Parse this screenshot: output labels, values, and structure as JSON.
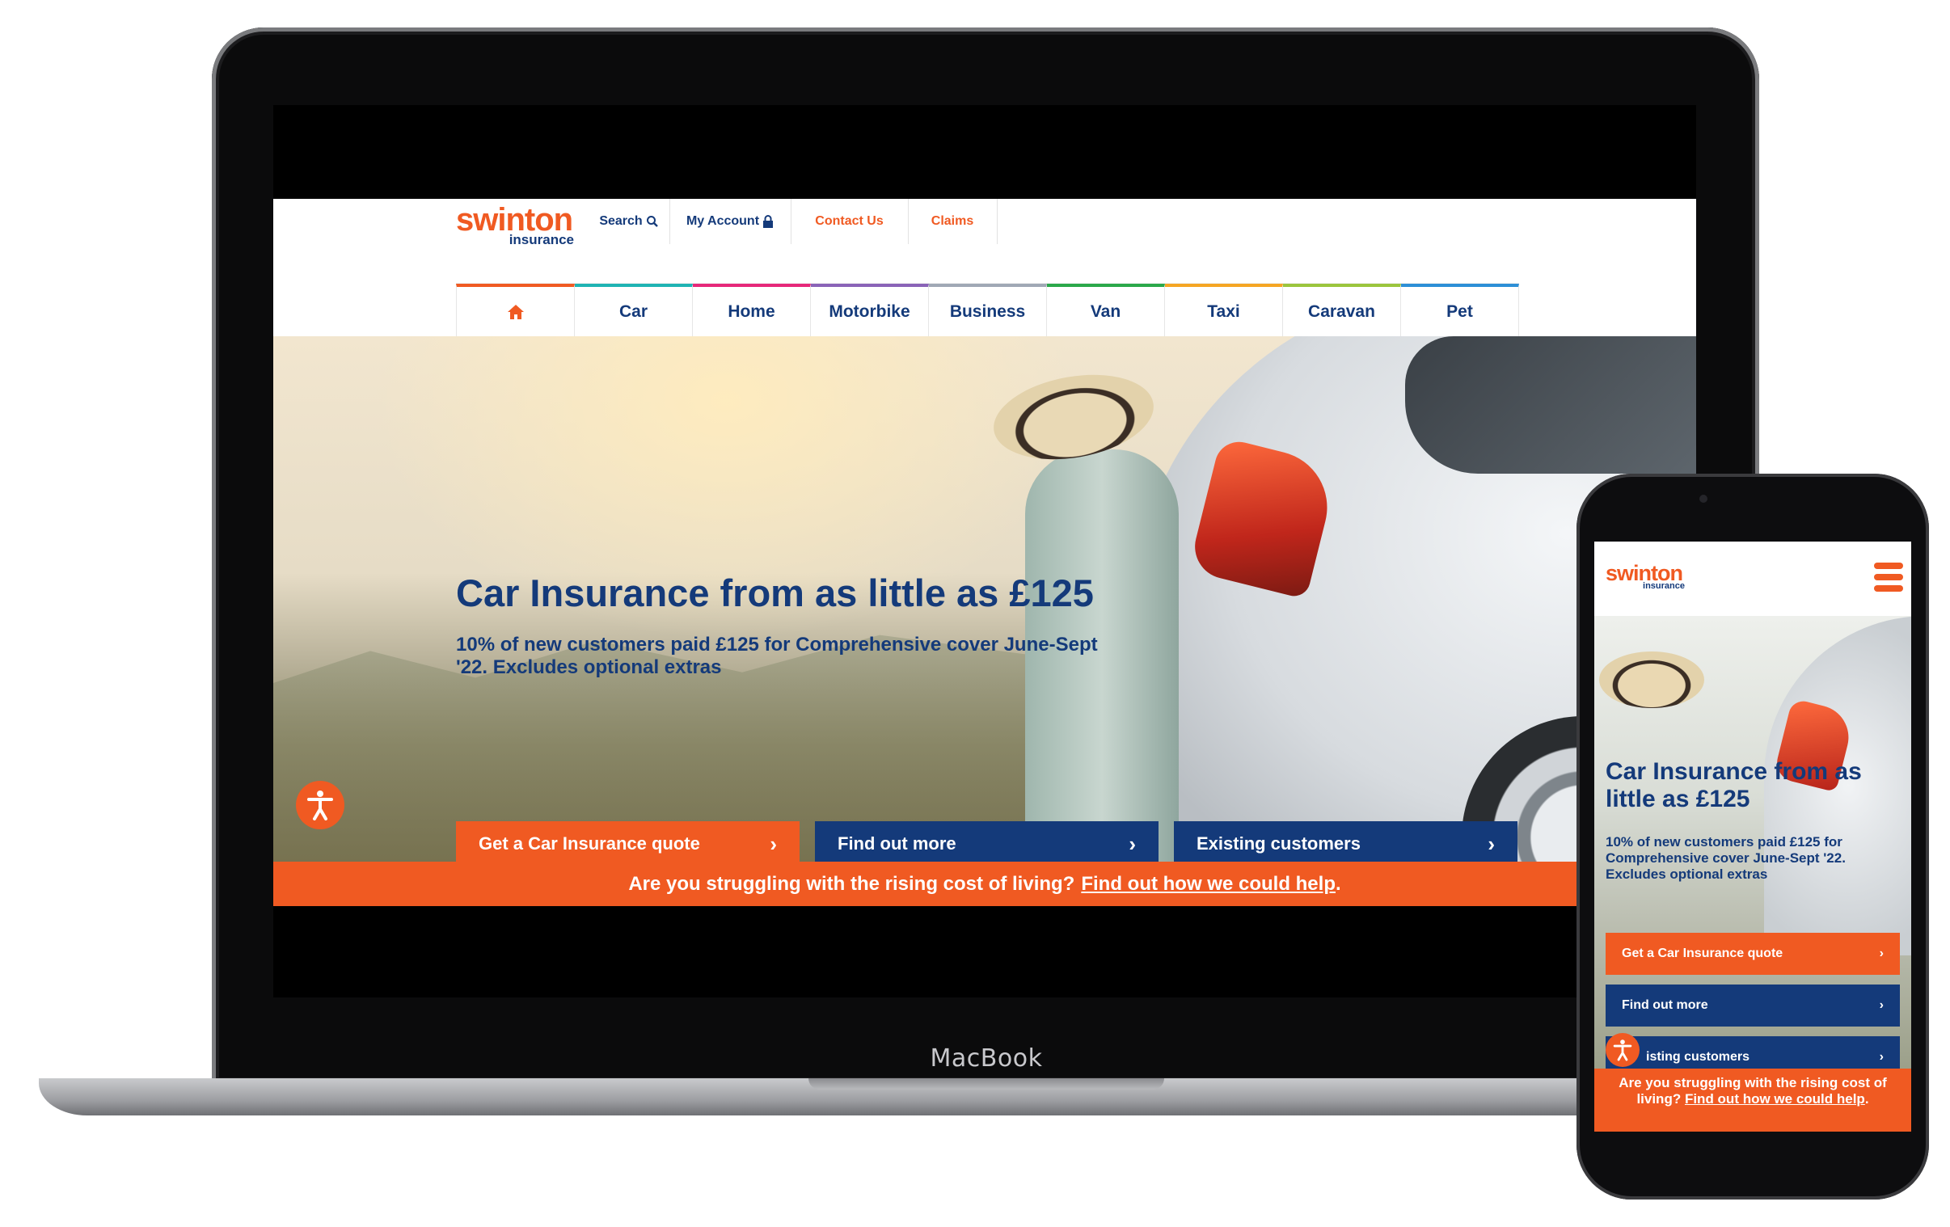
{
  "laptop": {
    "brand_label": "MacBook"
  },
  "brand": {
    "logo_word": "swinton",
    "logo_sub": "insurance",
    "primary": "#f05a22",
    "secondary": "#143a7a"
  },
  "desktop": {
    "utility_nav": [
      {
        "label": "Search",
        "icon": "search-icon"
      },
      {
        "label": "My Account",
        "icon": "lock-icon"
      },
      {
        "label": "Contact Us"
      },
      {
        "label": "Claims"
      }
    ],
    "main_nav": [
      {
        "label": "",
        "icon": "home-icon",
        "color": "#f05a22"
      },
      {
        "label": "Car",
        "color": "#1fb4b4"
      },
      {
        "label": "Home",
        "color": "#e6287a"
      },
      {
        "label": "Motorbike",
        "color": "#8a63b8"
      },
      {
        "label": "Business",
        "color": "#a0a8b5"
      },
      {
        "label": "Van",
        "color": "#2ba84a"
      },
      {
        "label": "Taxi",
        "color": "#f5a623"
      },
      {
        "label": "Caravan",
        "color": "#9bc53d"
      },
      {
        "label": "Pet",
        "color": "#2d8fd6"
      }
    ],
    "hero": {
      "title": "Car Insurance from as little as £125",
      "subtitle": "10% of new customers paid £125 for Comprehensive cover June-Sept '22. Excludes optional extras"
    },
    "ctas": [
      {
        "label": "Get a Car Insurance quote",
        "color": "#f05a22"
      },
      {
        "label": "Find out more",
        "color": "#143a7a"
      },
      {
        "label": "Existing customers",
        "color": "#143a7a"
      }
    ],
    "banner": {
      "text": "Are you struggling with the rising cost of living?",
      "link": "Find out how we could help",
      "suffix": "."
    }
  },
  "mobile": {
    "hero": {
      "title": "Car Insurance from as little as £125",
      "subtitle": "10% of new customers paid £125 for Comprehensive cover June-Sept '22. Excludes optional extras"
    },
    "ctas": [
      {
        "label": "Get a Car Insurance quote",
        "color": "#f05a22"
      },
      {
        "label": "Find out more",
        "color": "#143a7a"
      },
      {
        "label": "Existing customers",
        "color": "#143a7a",
        "visible_label": "isting customers"
      }
    ],
    "banner": {
      "text": "Are you struggling with the rising cost of living?",
      "link": "Find out how we could help",
      "suffix": "."
    }
  }
}
